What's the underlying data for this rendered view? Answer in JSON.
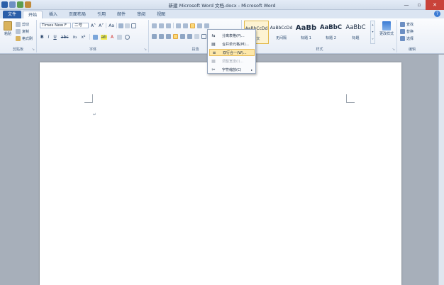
{
  "window": {
    "title": "新建 Microsoft Word 文档.docx - Microsoft Word",
    "controls": [
      "—",
      "▫",
      "✕"
    ]
  },
  "tabs": [
    {
      "label": "文件"
    },
    {
      "label": "开始"
    },
    {
      "label": "插入"
    },
    {
      "label": "页面布局"
    },
    {
      "label": "引用"
    },
    {
      "label": "邮件"
    },
    {
      "label": "审阅"
    },
    {
      "label": "视图"
    }
  ],
  "clipboard": {
    "paste": "粘贴",
    "cut": "剪切",
    "copy": "复制",
    "format_painter": "格式刷",
    "label": "剪贴板"
  },
  "font": {
    "name": "Times New F",
    "size": "二号",
    "grow": "A˄",
    "shrink": "A˅",
    "change_case": "Aa",
    "bold": "B",
    "italic": "I",
    "underline": "U",
    "strike": "abc",
    "sub": "x₂",
    "sup": "x²",
    "highlight": "ab",
    "color": "A",
    "label": "字体"
  },
  "paragraph": {
    "label": "段落"
  },
  "styles": {
    "items": [
      {
        "preview": "AaBbCcDd",
        "name": "正文"
      },
      {
        "preview": "AaBbCcDd",
        "name": "无间隔"
      },
      {
        "preview": "AaBb",
        "name": "标题 1"
      },
      {
        "preview": "AaBbC",
        "name": "标题 2"
      },
      {
        "preview": "AaBbC",
        "name": "标题"
      }
    ],
    "change": "更改样式",
    "label": "样式"
  },
  "editing": {
    "find": "查找",
    "replace": "替换",
    "select": "选择",
    "label": "编辑"
  },
  "menu": {
    "items": [
      {
        "icon": "⇆",
        "label": "分离表格(P)..."
      },
      {
        "icon": "▤",
        "label": "合并单元格(M)..."
      },
      {
        "icon": "≡",
        "label": "双行合一(W)..."
      },
      {
        "icon": "▦",
        "label": "调整宽度(I)..."
      },
      {
        "icon": "✂",
        "label": "字符缩放(C)"
      }
    ]
  },
  "document": {
    "paragraph_mark": "↵"
  },
  "colors": {
    "file_tab": "#2a5ea8",
    "highlight": "#fde7a8",
    "close": "#c9433a"
  }
}
